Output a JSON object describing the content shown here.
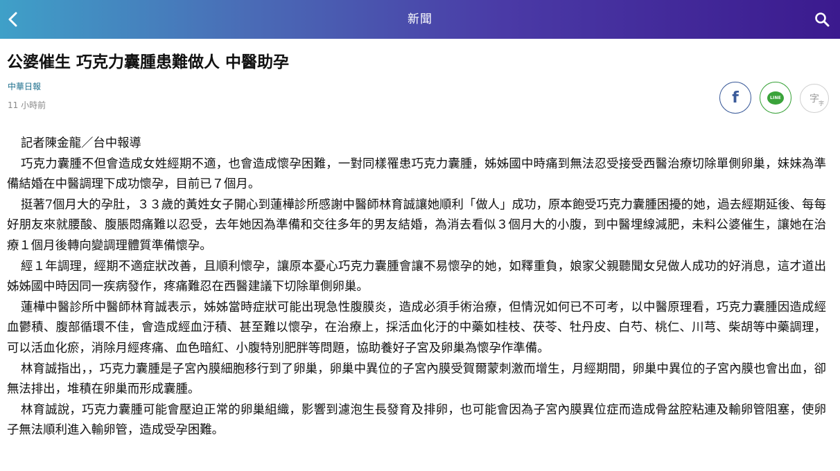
{
  "header": {
    "title": "新聞",
    "back_icon": "chevron-left-icon",
    "search_icon": "search-icon"
  },
  "article": {
    "headline": "公婆催生 巧克力囊腫患難做人 中醫助孕",
    "source": "中華日報",
    "time": "11 小時前",
    "paragraphs": [
      "記者陳金龍／台中報導",
      "巧克力囊腫不但會造成女姓經期不適，也會造成懷孕困難，一對同樣罹患巧克力囊腫，姊姊國中時痛到無法忍受接受西醫治療切除單側卵巢，妹妹為準備結婚在中醫調理下成功懷孕，目前已７個月。",
      "挺著7個月大的孕肚，３３歲的黃姓女子開心到蓮樺診所感謝中醫師林育誠讓她順利「做人」成功，原本飽受巧克力囊腫困擾的她，過去經期延後、每每好朋友來就腰酸、腹脹悶痛難以忍受，去年她因為準備和交往多年的男友結婚，為消去看似３個月大的小腹，到中醫埋線減肥，未料公婆催生，讓她在治療１個月後轉向變調理體質準備懷孕。",
      "經１年調理，經期不適症狀改善，且順利懷孕，讓原本憂心巧克力囊腫會讓不易懷孕的她，如釋重負，娘家父親聽聞女兒做人成功的好消息，這才道出姊姊國中時因同一疾病發作，疼痛難忍在西醫建議下切除單側卵巢。",
      "蓮樺中醫診所中醫師林育誠表示，姊姊當時症狀可能出現急性腹膜炎，造成必須手術治療，但情況如何已不可考，以中醫原理看，巧克力囊腫因造成經血鬱積、腹部循環不佳，會造成經血汙積、甚至難以懷孕，在治療上，採活血化汙的中藥如桂枝、茯苓、牡丹皮、白芍、桃仁、川芎、柴胡等中藥調理，可以活血化瘀，消除月經疼痛、血色暗紅、小腹特別肥胖等問題，協助養好子宮及卵巢為懷孕作準備。",
      "林育誠指出，，巧克力囊腫是子宮內膜細胞移行到了卵巢，卵巢中異位的子宮內膜受賀爾蒙刺激而增生，月經期間，卵巢中異位的子宮內膜也會出血，卻無法排出，堆積在卵巢而形成囊腫。",
      "林育誠說，巧克力囊腫可能會壓迫正常的卵巢組織，影響到濾泡生長發育及排卵，也可能會因為子宮內膜異位症而造成骨盆腔粘連及輸卵管阻塞，使卵子無法順利進入輸卵管，造成受孕困難。"
    ]
  },
  "share": {
    "facebook_glyph": "f",
    "line_label": "LINE",
    "font_glyph": "字",
    "font_glyph_small": "字",
    "facebook_icon": "facebook-icon",
    "line_icon": "line-icon",
    "font_size_icon": "font-size-icon"
  },
  "colors": {
    "header_gradient_start": "#3fa0c8",
    "header_gradient_end": "#3b1a8e",
    "source_link": "#1c6e8c",
    "facebook": "#3b5b9a",
    "line": "#3aa33a"
  }
}
